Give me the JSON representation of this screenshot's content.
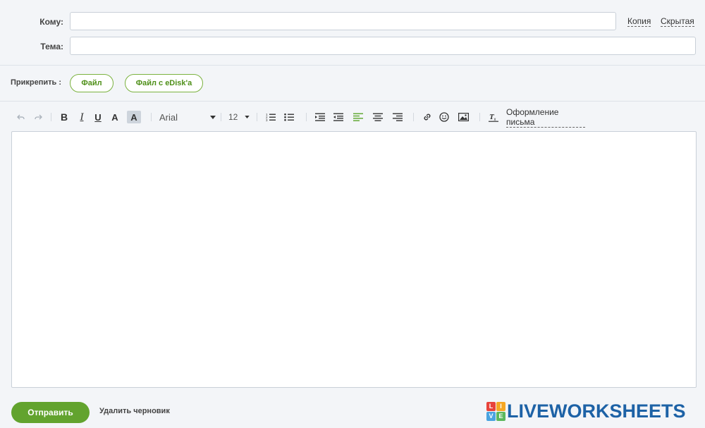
{
  "header": {
    "to_label": "Кому:",
    "to_value": "",
    "subject_label": "Тема:",
    "subject_value": "",
    "cc_link": "Копия",
    "bcc_link": "Скрытая"
  },
  "attach": {
    "label": "Прикрепить :",
    "file_button": "Файл",
    "edisk_button": "Файл с eDisk'a"
  },
  "toolbar": {
    "undo_icon": "undo-icon",
    "redo_icon": "redo-icon",
    "bold": "B",
    "italic": "I",
    "underline": "U",
    "text_color": "A",
    "bg_color": "A",
    "font_family": "Arial",
    "font_size": "12",
    "letter_design": "Оформление письма"
  },
  "editor": {
    "body": ""
  },
  "footer": {
    "send_button": "Отправить",
    "delete_draft": "Удалить черновик"
  },
  "logo": {
    "text": "LIVEWORKSHEETS",
    "grid_letters": [
      "L",
      "I",
      "V",
      "E"
    ],
    "grid_colors": [
      "#e8433b",
      "#f5a623",
      "#4aa4e0",
      "#5cb85c"
    ]
  },
  "colors": {
    "accent_green": "#62a32e",
    "pill_border": "#7bb23f",
    "logo_blue": "#1d62a6",
    "background": "#f3f5f8"
  }
}
